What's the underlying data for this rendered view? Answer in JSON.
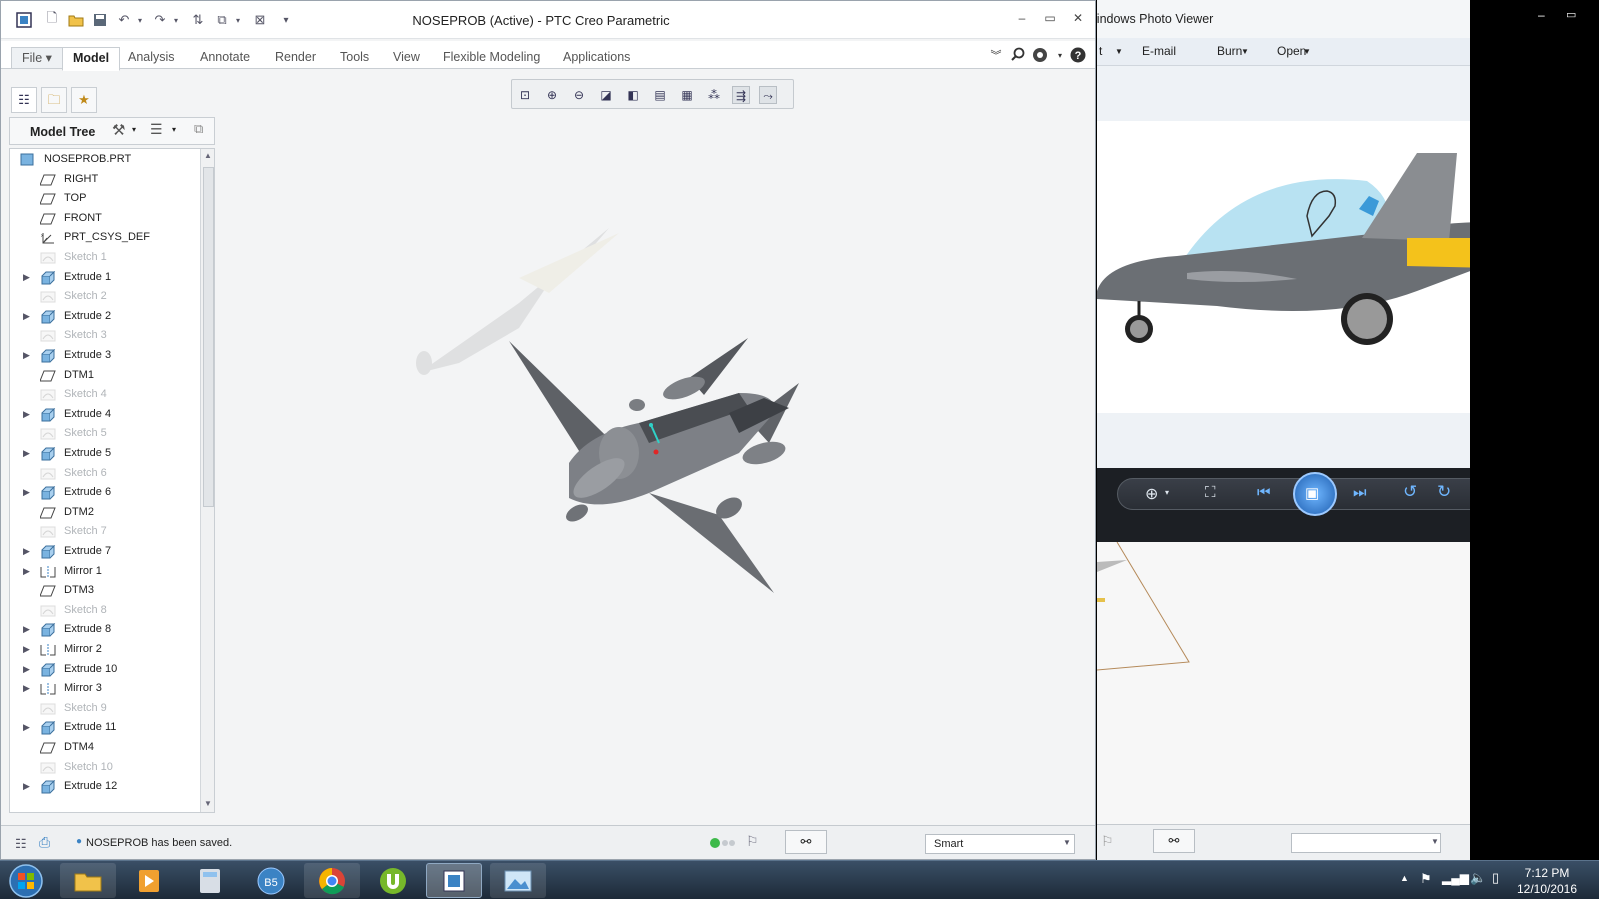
{
  "creo": {
    "title": "NOSEPROB (Active) - PTC Creo Parametric",
    "tabs": [
      "File ▾",
      "Model",
      "Analysis",
      "Annotate",
      "Render",
      "Tools",
      "View",
      "Flexible Modeling",
      "Applications"
    ],
    "active_tab": "Model",
    "model_tree_label": "Model Tree",
    "tree": [
      {
        "label": "NOSEPROB.PRT",
        "icon": "part-icon",
        "expand": false,
        "dim": false
      },
      {
        "label": "RIGHT",
        "icon": "datum-plane-icon",
        "expand": false,
        "dim": false
      },
      {
        "label": "TOP",
        "icon": "datum-plane-icon",
        "expand": false,
        "dim": false
      },
      {
        "label": "FRONT",
        "icon": "datum-plane-icon",
        "expand": false,
        "dim": false
      },
      {
        "label": "PRT_CSYS_DEF",
        "icon": "csys-icon",
        "expand": false,
        "dim": false
      },
      {
        "label": "Sketch 1",
        "icon": "sketch-icon",
        "expand": false,
        "dim": true
      },
      {
        "label": "Extrude 1",
        "icon": "extrude-icon",
        "expand": true,
        "dim": false
      },
      {
        "label": "Sketch 2",
        "icon": "sketch-icon",
        "expand": false,
        "dim": true
      },
      {
        "label": "Extrude 2",
        "icon": "extrude-icon",
        "expand": true,
        "dim": false
      },
      {
        "label": "Sketch 3",
        "icon": "sketch-icon",
        "expand": false,
        "dim": true
      },
      {
        "label": "Extrude 3",
        "icon": "extrude-icon",
        "expand": true,
        "dim": false
      },
      {
        "label": "DTM1",
        "icon": "datum-plane-icon",
        "expand": false,
        "dim": false
      },
      {
        "label": "Sketch 4",
        "icon": "sketch-icon",
        "expand": false,
        "dim": true
      },
      {
        "label": "Extrude 4",
        "icon": "extrude-icon",
        "expand": true,
        "dim": false
      },
      {
        "label": "Sketch 5",
        "icon": "sketch-icon",
        "expand": false,
        "dim": true
      },
      {
        "label": "Extrude 5",
        "icon": "extrude-icon",
        "expand": true,
        "dim": false
      },
      {
        "label": "Sketch 6",
        "icon": "sketch-icon",
        "expand": false,
        "dim": true
      },
      {
        "label": "Extrude 6",
        "icon": "extrude-icon",
        "expand": true,
        "dim": false
      },
      {
        "label": "DTM2",
        "icon": "datum-plane-icon",
        "expand": false,
        "dim": false
      },
      {
        "label": "Sketch 7",
        "icon": "sketch-icon",
        "expand": false,
        "dim": true
      },
      {
        "label": "Extrude 7",
        "icon": "extrude-icon",
        "expand": true,
        "dim": false
      },
      {
        "label": "Mirror 1",
        "icon": "mirror-icon",
        "expand": true,
        "dim": false
      },
      {
        "label": "DTM3",
        "icon": "datum-plane-icon",
        "expand": false,
        "dim": false
      },
      {
        "label": "Sketch 8",
        "icon": "sketch-icon",
        "expand": false,
        "dim": true
      },
      {
        "label": "Extrude 8",
        "icon": "extrude-icon",
        "expand": true,
        "dim": false
      },
      {
        "label": "Mirror 2",
        "icon": "mirror-icon",
        "expand": true,
        "dim": false
      },
      {
        "label": "Extrude 10",
        "icon": "extrude-icon",
        "expand": true,
        "dim": false
      },
      {
        "label": "Mirror 3",
        "icon": "mirror-icon",
        "expand": true,
        "dim": false
      },
      {
        "label": "Sketch 9",
        "icon": "sketch-icon",
        "expand": false,
        "dim": true
      },
      {
        "label": "Extrude 11",
        "icon": "extrude-icon",
        "expand": true,
        "dim": false
      },
      {
        "label": "DTM4",
        "icon": "datum-plane-icon",
        "expand": false,
        "dim": false
      },
      {
        "label": "Sketch 10",
        "icon": "sketch-icon",
        "expand": false,
        "dim": true
      },
      {
        "label": "Extrude 12",
        "icon": "extrude-icon",
        "expand": true,
        "dim": false
      }
    ],
    "status_message": "NOSEPROB has been saved.",
    "filter_value": "Smart"
  },
  "photo_viewer": {
    "title": "Windows Photo Viewer",
    "menu": [
      "t",
      "E-mail",
      "Burn",
      "Open"
    ]
  },
  "taskbar": {
    "time": "7:12 PM",
    "date": "12/10/2016",
    "apps": [
      "start-button",
      "explorer-icon",
      "media-player-icon",
      "calculator-icon",
      "b5-app-icon",
      "chrome-icon",
      "utorrent-icon",
      "creo-icon",
      "photo-viewer-icon"
    ],
    "b5_label": "B5"
  },
  "colors": {
    "accent": "#3b83c4",
    "aircraft": "#6b6f74",
    "canopy": "#b8e2f2",
    "tail_yellow": "#f4c21b"
  }
}
